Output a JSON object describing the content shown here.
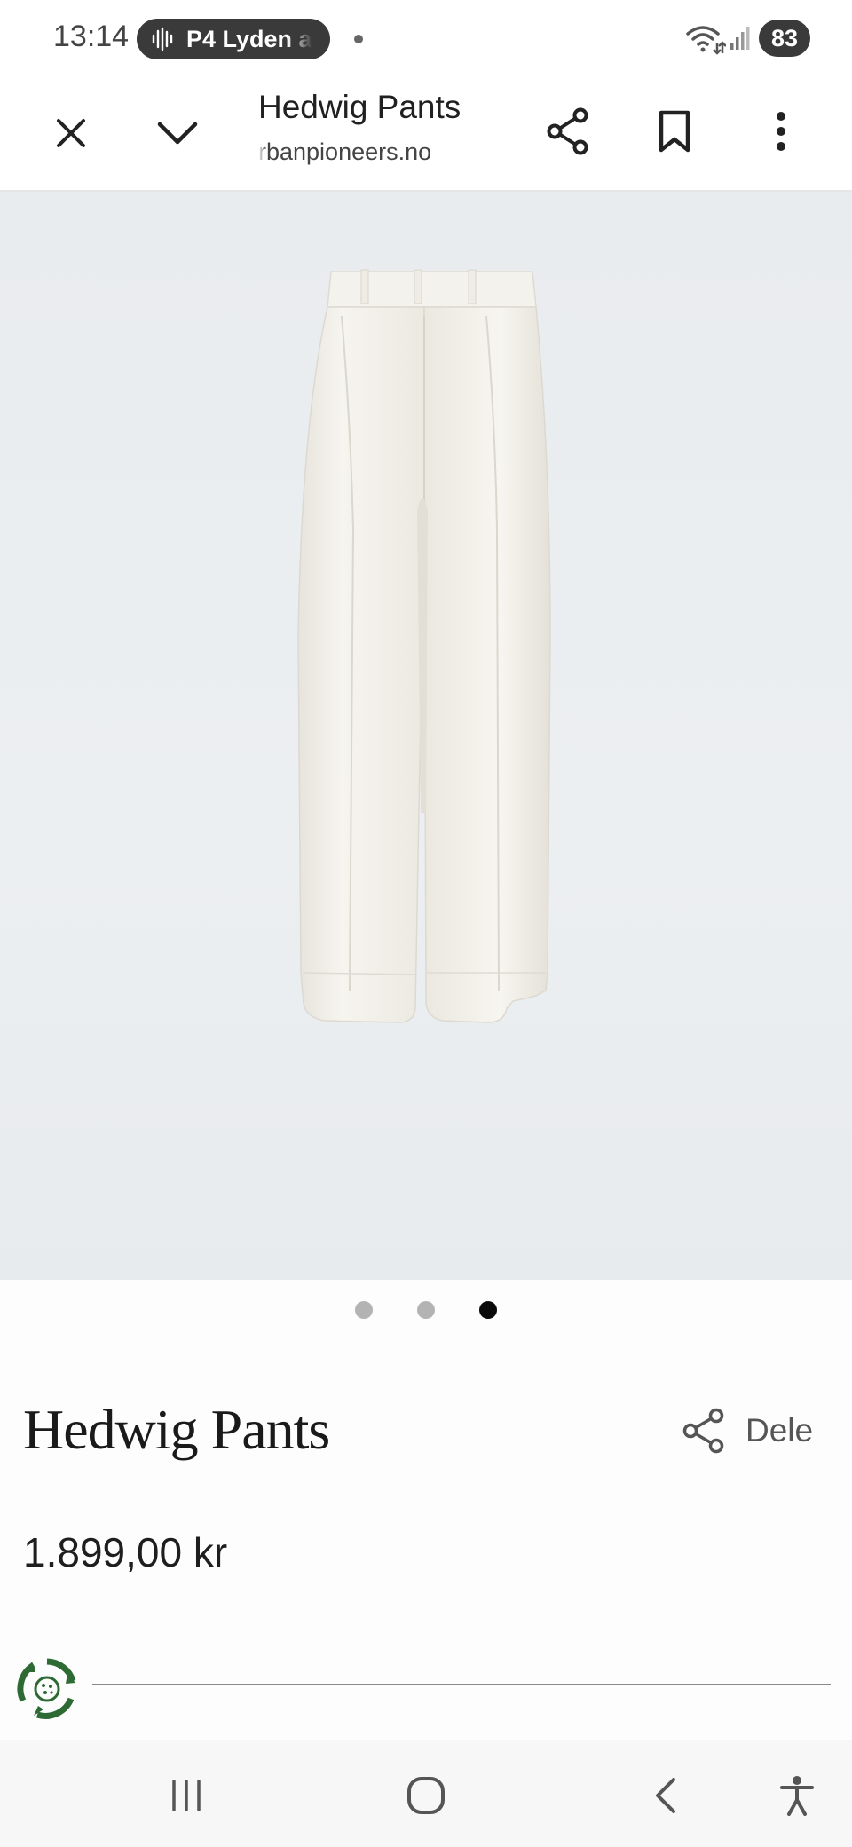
{
  "status_bar": {
    "time": "13:14",
    "media_pill_text": "P4 Lyden a",
    "battery": "83",
    "icons": [
      "sound-wave-icon",
      "notification-dot-icon",
      "wifi-icon",
      "signal-icon",
      "battery-icon"
    ]
  },
  "toolbar": {
    "title": "Hedwig Pants",
    "url": "rbanpioneers.no",
    "icons": [
      "close-icon",
      "chevron-down-icon",
      "share-icon",
      "bookmark-icon",
      "more-vert-icon"
    ]
  },
  "carousel": {
    "total_dots": 3,
    "active_index": 2
  },
  "product": {
    "name": "Hedwig Pants",
    "share_label": "Dele",
    "price": "1.899,00 kr"
  },
  "nav_bar": {
    "icons": [
      "recents-icon",
      "home-icon",
      "back-icon",
      "accessibility-icon"
    ]
  },
  "colors": {
    "accent_dark": "#0a0a0a",
    "eco_green": "#2e6b34",
    "pill_bg": "#3a3a3a",
    "image_bg": "#eaedf0"
  }
}
